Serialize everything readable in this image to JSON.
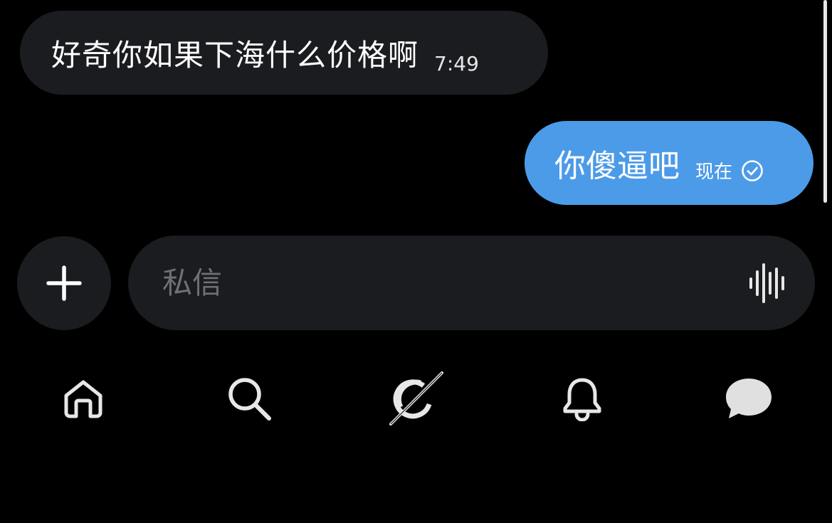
{
  "messages": {
    "incoming": {
      "text": "好奇你如果下海什么价格啊",
      "time": "7:49"
    },
    "outgoing": {
      "text": "你傻逼吧",
      "time": "现在",
      "status_icon": "check-circle-icon"
    }
  },
  "composer": {
    "placeholder": "私信",
    "value": "",
    "add_icon": "plus-icon",
    "voice_icon": "voice-waveform-icon"
  },
  "nav": {
    "items": [
      {
        "icon": "home-icon"
      },
      {
        "icon": "search-icon"
      },
      {
        "icon": "grok-icon"
      },
      {
        "icon": "bell-icon"
      },
      {
        "icon": "messages-icon"
      }
    ]
  },
  "colors": {
    "background": "#000000",
    "bubble_incoming": "#1b1c1f",
    "bubble_outgoing": "#4c9be8",
    "placeholder": "#6e7074",
    "icon": "#e7e7e7"
  }
}
